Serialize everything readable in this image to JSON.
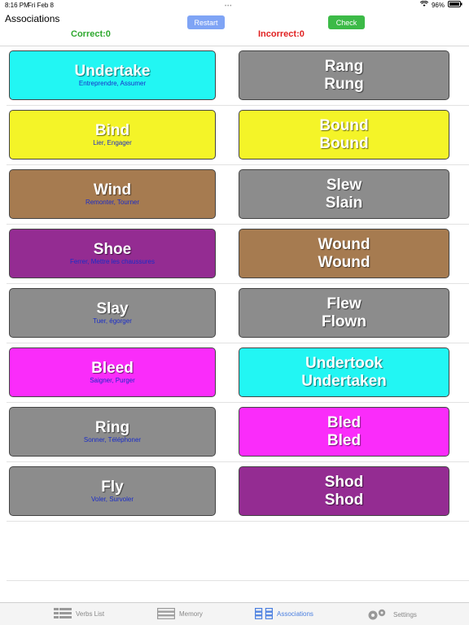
{
  "status_bar": {
    "time": "8:16 PM",
    "date": "Fri Feb 8",
    "battery": "96%"
  },
  "header": {
    "title": "Associations",
    "restart_label": "Restart",
    "check_label": "Check",
    "correct_text": "Correct:0",
    "incorrect_text": "Incorrect:0"
  },
  "rows": [
    {
      "left": {
        "word": "Undertake",
        "translation": "Entreprendre, Assumer",
        "color": "#22f6f3"
      },
      "right": {
        "past": "Rang",
        "participle": "Rung",
        "color": "#8c8c8c"
      }
    },
    {
      "left": {
        "word": "Bind",
        "translation": "Lier, Engager",
        "color": "#f4f428"
      },
      "right": {
        "past": "Bound",
        "participle": "Bound",
        "color": "#f4f428"
      }
    },
    {
      "left": {
        "word": "Wind",
        "translation": "Remonter, Tourner",
        "color": "#a67b50"
      },
      "right": {
        "past": "Slew",
        "participle": "Slain",
        "color": "#8c8c8c"
      }
    },
    {
      "left": {
        "word": "Shoe",
        "translation": "Ferrer, Mettre les chaussures",
        "color": "#942c92"
      },
      "right": {
        "past": "Wound",
        "participle": "Wound",
        "color": "#a67b50"
      }
    },
    {
      "left": {
        "word": "Slay",
        "translation": "Tuer, égorger",
        "color": "#8c8c8c"
      },
      "right": {
        "past": "Flew",
        "participle": "Flown",
        "color": "#8c8c8c"
      }
    },
    {
      "left": {
        "word": "Bleed",
        "translation": "Saigner, Purger",
        "color": "#fa2cfa"
      },
      "right": {
        "past": "Undertook",
        "participle": "Undertaken",
        "color": "#22f6f3"
      }
    },
    {
      "left": {
        "word": "Ring",
        "translation": "Sonner, Téléphoner",
        "color": "#8c8c8c"
      },
      "right": {
        "past": "Bled",
        "participle": "Bled",
        "color": "#fa2cfa"
      }
    },
    {
      "left": {
        "word": "Fly",
        "translation": "Voler, Survoler",
        "color": "#8c8c8c"
      },
      "right": {
        "past": "Shod",
        "participle": "Shod",
        "color": "#942c92"
      }
    }
  ],
  "tabbar": {
    "tabs": [
      {
        "label": "Verbs List",
        "icon": "list-icon",
        "active": false
      },
      {
        "label": "Memory",
        "icon": "memory-icon",
        "active": false
      },
      {
        "label": "Associations",
        "icon": "associations-icon",
        "active": true
      },
      {
        "label": "Settings",
        "icon": "gear-icon",
        "active": false
      }
    ]
  },
  "colors": {
    "accent": "#4a7fe0",
    "correct": "#2ea82e",
    "incorrect": "#e02020",
    "restart": "#7fa4f5",
    "check": "#3cba47"
  }
}
